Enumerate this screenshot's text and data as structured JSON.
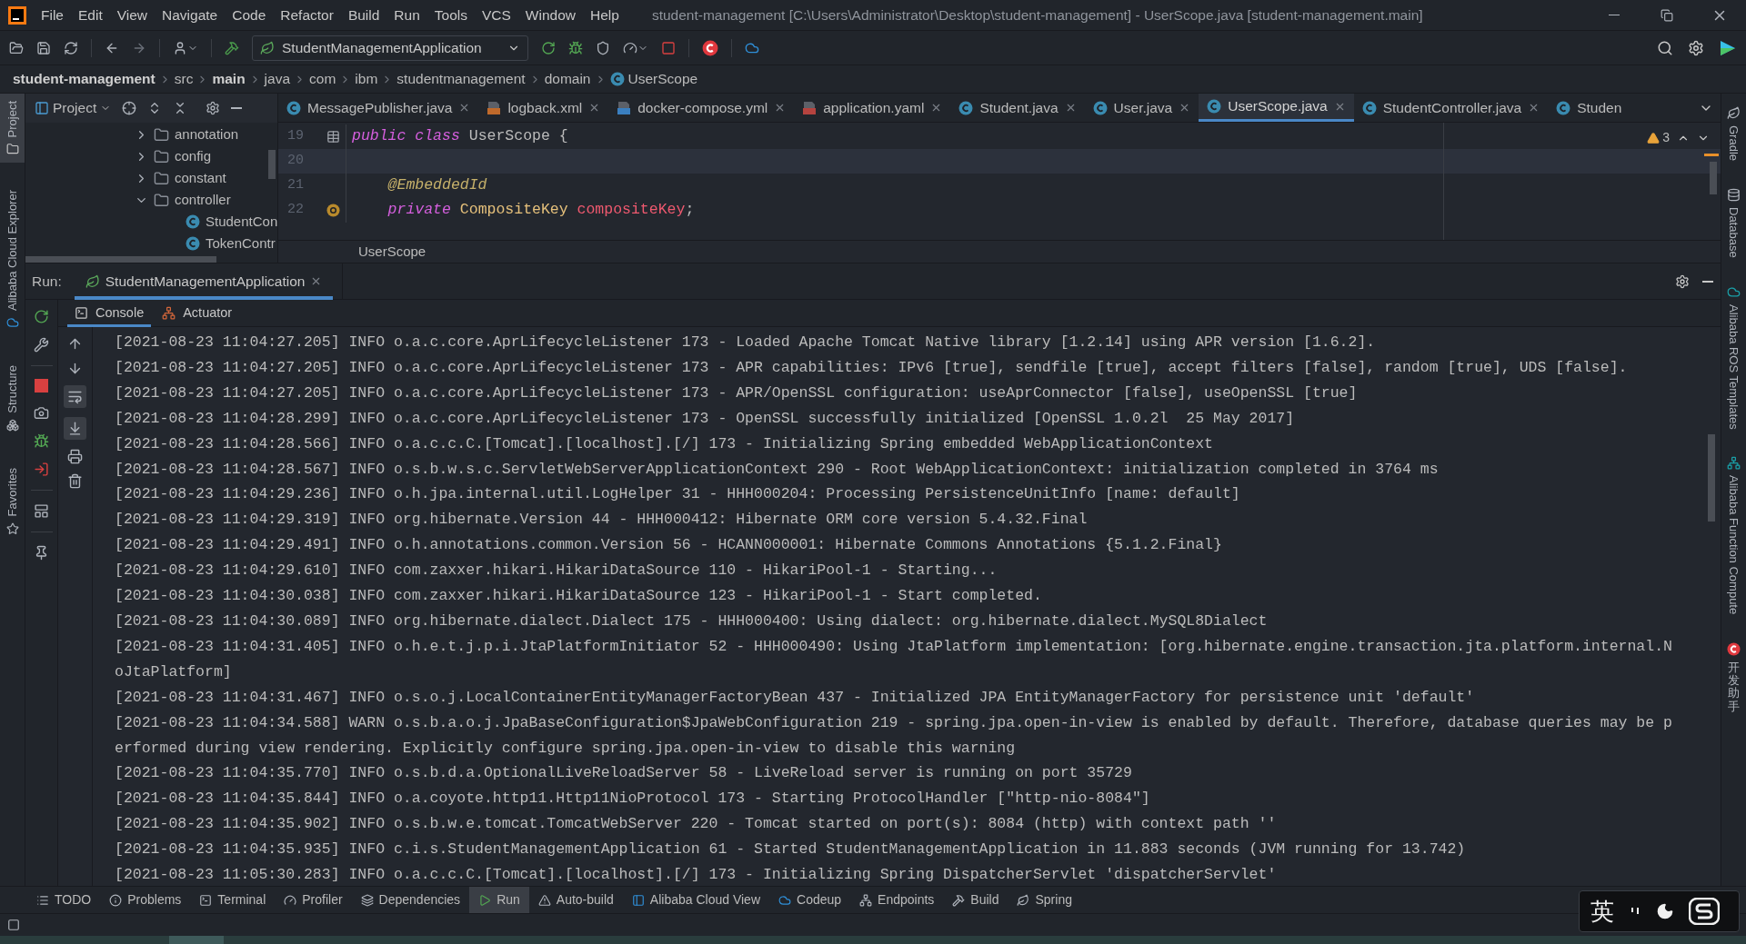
{
  "window": {
    "title": "student-management [C:\\Users\\Administrator\\Desktop\\student-management] - UserScope.java [student-management.main]"
  },
  "menu": [
    "File",
    "Edit",
    "View",
    "Navigate",
    "Code",
    "Refactor",
    "Build",
    "Run",
    "Tools",
    "VCS",
    "Window",
    "Help"
  ],
  "run_config": "StudentManagementApplication",
  "breadcrumb": [
    {
      "label": "student-management",
      "bold": true,
      "kind": "folder"
    },
    {
      "label": "src",
      "bold": false,
      "kind": "folder"
    },
    {
      "label": "main",
      "bold": true,
      "kind": "folder"
    },
    {
      "label": "java",
      "bold": false,
      "kind": "folder"
    },
    {
      "label": "com",
      "bold": false,
      "kind": "folder"
    },
    {
      "label": "ibm",
      "bold": false,
      "kind": "folder"
    },
    {
      "label": "studentmanagement",
      "bold": false,
      "kind": "folder"
    },
    {
      "label": "domain",
      "bold": false,
      "kind": "folder"
    },
    {
      "label": "UserScope",
      "bold": false,
      "kind": "class"
    }
  ],
  "left_stripe": [
    {
      "label": "Project",
      "selected": true
    },
    {
      "label": "Alibaba Cloud Explorer",
      "selected": false
    },
    {
      "label": "Structure",
      "selected": false
    },
    {
      "label": "Favorites",
      "selected": false
    }
  ],
  "right_stripe": [
    "Gradle",
    "Database",
    "Alibaba ROS Templates",
    "Alibaba Function Compute",
    "开发助手"
  ],
  "project_panel": {
    "title": "Project",
    "tree": [
      {
        "label": "annotation",
        "expanded": false
      },
      {
        "label": "config",
        "expanded": false
      },
      {
        "label": "constant",
        "expanded": false
      },
      {
        "label": "controller",
        "expanded": true,
        "children": [
          {
            "label": "StudentCon"
          },
          {
            "label": "TokenContr"
          }
        ]
      }
    ]
  },
  "editor_tabs": [
    {
      "label": "MessagePublisher.java",
      "kind": "class",
      "selected": false,
      "closable": true
    },
    {
      "label": "logback.xml",
      "kind": "xml",
      "selected": false,
      "closable": true
    },
    {
      "label": "docker-compose.yml",
      "kind": "docker",
      "selected": false,
      "closable": true
    },
    {
      "label": "application.yaml",
      "kind": "yaml",
      "selected": false,
      "closable": true
    },
    {
      "label": "Student.java",
      "kind": "class",
      "selected": false,
      "closable": true
    },
    {
      "label": "User.java",
      "kind": "class",
      "selected": false,
      "closable": true
    },
    {
      "label": "UserScope.java",
      "kind": "class",
      "selected": true,
      "closable": true
    },
    {
      "label": "StudentController.java",
      "kind": "class",
      "selected": false,
      "closable": true
    },
    {
      "label": "Studen",
      "kind": "class",
      "selected": false,
      "closable": false
    }
  ],
  "editor": {
    "warnings": "3",
    "breadcrumb": "UserScope",
    "lines": [
      {
        "number": "19",
        "current": false,
        "entity_marker": true,
        "field_marker": false,
        "tokens": [
          {
            "kind": "keyword",
            "text": "public class"
          },
          {
            "kind": "plain",
            "text": " UserScope {"
          }
        ]
      },
      {
        "number": "20",
        "current": true,
        "entity_marker": false,
        "field_marker": false
      },
      {
        "number": "21",
        "current": false,
        "entity_marker": false,
        "field_marker": false,
        "tokens": [
          {
            "kind": "annotation",
            "text": "    @EmbeddedId"
          }
        ]
      },
      {
        "number": "22",
        "current": false,
        "entity_marker": false,
        "field_marker": true,
        "tokens": [
          {
            "kind": "keyword",
            "text": "    private"
          },
          {
            "kind": "type",
            "text": " CompositeKey"
          },
          {
            "kind": "field",
            "text": " compositeKey"
          },
          {
            "kind": "plain",
            "text": ";"
          }
        ]
      }
    ]
  },
  "run_panel": {
    "label": "Run:",
    "tabs": [
      {
        "label": "StudentManagementApplication",
        "selected": true
      }
    ],
    "console_tabs": [
      {
        "label": "Console",
        "selected": true
      },
      {
        "label": "Actuator",
        "selected": false
      }
    ],
    "soft_wrap": true,
    "scroll_to_end": true,
    "log": [
      "[2021-08-23 11:04:27.205] INFO o.a.c.core.AprLifecycleListener 173 - Loaded Apache Tomcat Native library [1.2.14] using APR version [1.6.2].",
      "[2021-08-23 11:04:27.205] INFO o.a.c.core.AprLifecycleListener 173 - APR capabilities: IPv6 [true], sendfile [true], accept filters [false], random [true], UDS [false].",
      "[2021-08-23 11:04:27.205] INFO o.a.c.core.AprLifecycleListener 173 - APR/OpenSSL configuration: useAprConnector [false], useOpenSSL [true]",
      "[2021-08-23 11:04:28.299] INFO o.a.c.core.AprLifecycleListener 173 - OpenSSL successfully initialized [OpenSSL 1.0.2l  25 May 2017]",
      "[2021-08-23 11:04:28.566] INFO o.a.c.c.C.[Tomcat].[localhost].[/] 173 - Initializing Spring embedded WebApplicationContext",
      "[2021-08-23 11:04:28.567] INFO o.s.b.w.s.c.ServletWebServerApplicationContext 290 - Root WebApplicationContext: initialization completed in 3764 ms",
      "[2021-08-23 11:04:29.236] INFO o.h.jpa.internal.util.LogHelper 31 - HHH000204: Processing PersistenceUnitInfo [name: default]",
      "[2021-08-23 11:04:29.319] INFO org.hibernate.Version 44 - HHH000412: Hibernate ORM core version 5.4.32.Final",
      "[2021-08-23 11:04:29.491] INFO o.h.annotations.common.Version 56 - HCANN000001: Hibernate Commons Annotations {5.1.2.Final}",
      "[2021-08-23 11:04:29.610] INFO com.zaxxer.hikari.HikariDataSource 110 - HikariPool-1 - Starting...",
      "[2021-08-23 11:04:30.038] INFO com.zaxxer.hikari.HikariDataSource 123 - HikariPool-1 - Start completed.",
      "[2021-08-23 11:04:30.089] INFO org.hibernate.dialect.Dialect 175 - HHH000400: Using dialect: org.hibernate.dialect.MySQL8Dialect",
      "[2021-08-23 11:04:31.405] INFO o.h.e.t.j.p.i.JtaPlatformInitiator 52 - HHH000490: Using JtaPlatform implementation: [org.hibernate.engine.transaction.jta.platform.internal.NoJtaPlatform]",
      "[2021-08-23 11:04:31.467] INFO o.s.o.j.LocalContainerEntityManagerFactoryBean 437 - Initialized JPA EntityManagerFactory for persistence unit 'default'",
      "[2021-08-23 11:04:34.588] WARN o.s.b.a.o.j.JpaBaseConfiguration$JpaWebConfiguration 219 - spring.jpa.open-in-view is enabled by default. Therefore, database queries may be performed during view rendering. Explicitly configure spring.jpa.open-in-view to disable this warning",
      "[2021-08-23 11:04:35.770] INFO o.s.b.d.a.OptionalLiveReloadServer 58 - LiveReload server is running on port 35729",
      "[2021-08-23 11:04:35.844] INFO o.a.coyote.http11.Http11NioProtocol 173 - Starting ProtocolHandler [\"http-nio-8084\"]",
      "[2021-08-23 11:04:35.902] INFO o.s.b.w.e.tomcat.TomcatWebServer 220 - Tomcat started on port(s): 8084 (http) with context path ''",
      "[2021-08-23 11:04:35.935] INFO c.i.s.StudentManagementApplication 61 - Started StudentManagementApplication in 11.883 seconds (JVM running for 13.742)",
      "[2021-08-23 11:05:30.283] INFO o.a.c.c.C.[Tomcat].[localhost].[/] 173 - Initializing Spring DispatcherServlet 'dispatcherServlet'"
    ]
  },
  "tool_windows": [
    {
      "label": "TODO",
      "selected": false
    },
    {
      "label": "Problems",
      "selected": false
    },
    {
      "label": "Terminal",
      "selected": false
    },
    {
      "label": "Profiler",
      "selected": false
    },
    {
      "label": "Dependencies",
      "selected": false
    },
    {
      "label": "Run",
      "selected": true
    },
    {
      "label": "Auto-build",
      "selected": false
    },
    {
      "label": "Alibaba Cloud View",
      "selected": false
    },
    {
      "label": "Codeup",
      "selected": false
    },
    {
      "label": "Endpoints",
      "selected": false
    },
    {
      "label": "Build",
      "selected": false
    },
    {
      "label": "Spring",
      "selected": false
    }
  ],
  "ime": {
    "label": "英"
  }
}
